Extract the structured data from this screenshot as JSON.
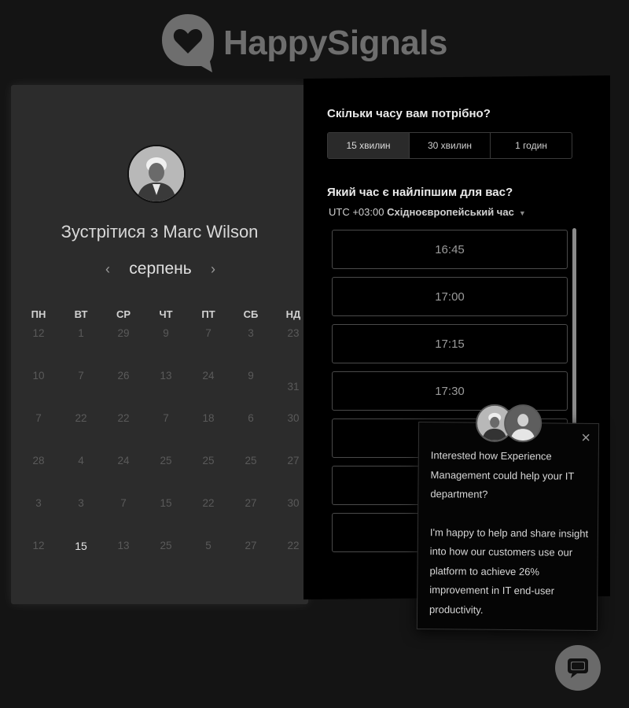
{
  "brand": {
    "name": "HappySignals",
    "icon": "heart-speech-bubble-icon"
  },
  "host": {
    "title": "Зустрітися з Marc Wilson"
  },
  "calendar": {
    "month": "серпень",
    "prev": "‹",
    "next": "›",
    "weekdays": [
      "ПН",
      "ВТ",
      "СР",
      "ЧТ",
      "ПТ",
      "СБ",
      "НД"
    ],
    "days": [
      "12",
      "1",
      "29",
      "9",
      "7",
      "3",
      "23",
      "10",
      "7",
      "26",
      "13",
      "24",
      "9",
      "31",
      "7",
      "22",
      "22",
      "7",
      "18",
      "6",
      "30",
      "28",
      "4",
      "24",
      "25",
      "25",
      "25",
      "27",
      "3",
      "3",
      "7",
      "15",
      "22",
      "27",
      "30",
      "12",
      "15",
      "13",
      "25",
      "5",
      "27",
      "22"
    ],
    "selected_index": 13,
    "available_index": 36
  },
  "duration": {
    "question": "Скільки часу вам потрібно?",
    "options": [
      "15 хвилин",
      "30 хвилин",
      "1 годин"
    ],
    "active": 0
  },
  "time": {
    "question": "Який час є найліпшим для вас?",
    "tz_offset": "UTC +03:00",
    "tz_name": "Східноєвропейський час",
    "slots": [
      "16:45",
      "17:00",
      "17:15",
      "17:30",
      "",
      "",
      "",
      ""
    ]
  },
  "popup": {
    "paragraph1": "Interested how Experience Management could help your IT department?",
    "paragraph2": "I'm happy to help and share insight into how our customers use our platform to achieve 26% improvement in IT end-user productivity.",
    "close": "×"
  },
  "colors": {
    "selected_day_bg": "#d6d6d6",
    "panel_left": "#2c2c2c",
    "panel_right": "#000000"
  }
}
